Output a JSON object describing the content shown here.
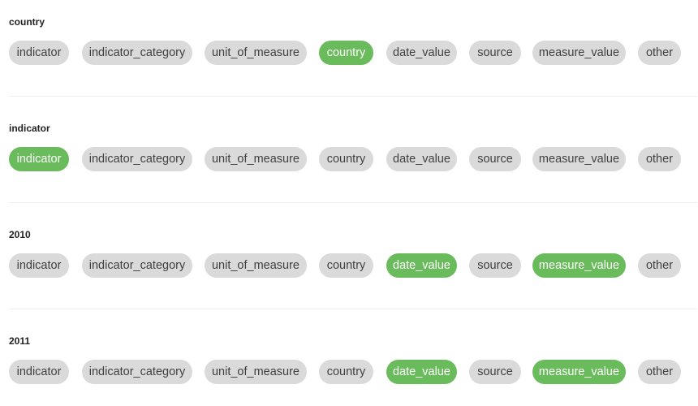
{
  "colors": {
    "chip_default_bg": "#dadada",
    "chip_selected_bg": "#69bb5b",
    "chip_text": "#404040",
    "chip_selected_text": "#ffffff"
  },
  "chip_labels": [
    "indicator",
    "indicator_category",
    "unit_of_measure",
    "country",
    "date_value",
    "source",
    "measure_value",
    "other"
  ],
  "groups": [
    {
      "title": "country",
      "selected": [
        "country"
      ]
    },
    {
      "title": "indicator",
      "selected": [
        "indicator"
      ]
    },
    {
      "title": "2010",
      "selected": [
        "date_value",
        "measure_value"
      ]
    },
    {
      "title": "2011",
      "selected": [
        "date_value",
        "measure_value"
      ]
    }
  ]
}
